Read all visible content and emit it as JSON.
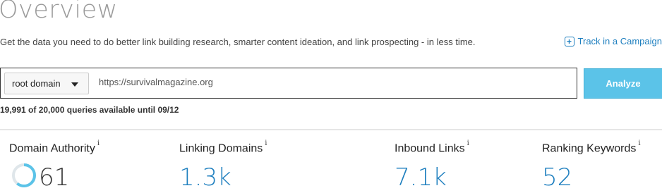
{
  "header": {
    "title": "Overview",
    "subtitle": "Get the data you need to do better link building research, smarter content ideation, and link prospecting - in less time.",
    "track_link": "Track in a Campaign"
  },
  "search": {
    "scope_selected": "root domain",
    "url_value": "https://survivalmagazine.org",
    "analyze_label": "Analyze",
    "quota_text": "19,991 of 20,000 queries available until 09/12"
  },
  "metrics": {
    "domain_authority": {
      "label": "Domain Authority",
      "info": "i",
      "value": "61",
      "gauge_fraction": 0.61
    },
    "linking_domains": {
      "label": "Linking Domains",
      "info": "i",
      "value": "1.3k"
    },
    "inbound_links": {
      "label": "Inbound Links",
      "info": "i",
      "value": "7.1k"
    },
    "ranking_keywords": {
      "label": "Ranking Keywords",
      "info": "i",
      "value": "52"
    }
  },
  "colors": {
    "accent": "#1e7fbf",
    "button": "#5bc3e8",
    "gauge_fill": "#5bc3e8",
    "gauge_track": "#dfe6ea"
  }
}
